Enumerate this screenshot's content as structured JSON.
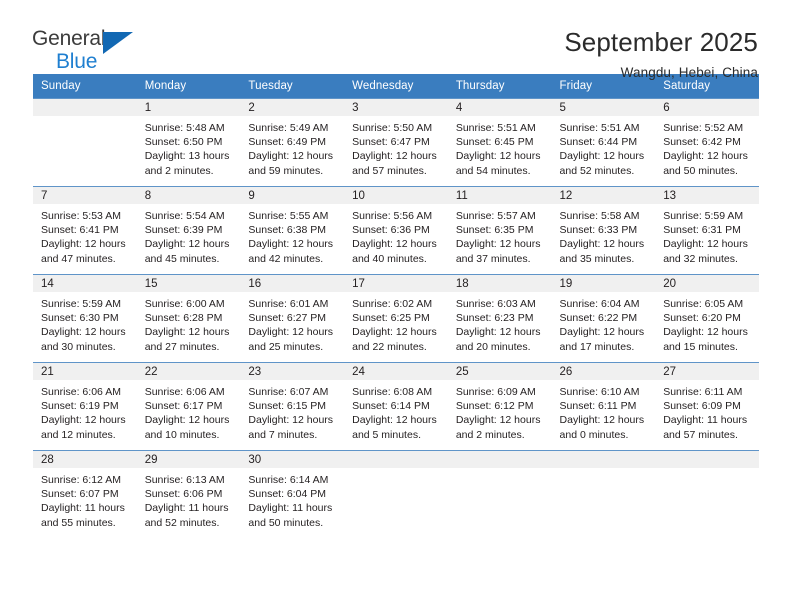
{
  "logo": {
    "word_top": "General",
    "word_bottom": "Blue",
    "triangle_color": "#1268b3",
    "blue_color": "#1f7fd0"
  },
  "header": {
    "title": "September 2025",
    "subtitle": "Wangdu, Hebei, China"
  },
  "theme": {
    "header_blue": "#3a7dbf",
    "daynum_band": "#f0f0f0",
    "text": "#231f20"
  },
  "calendar": {
    "weekday_headers": [
      "Sunday",
      "Monday",
      "Tuesday",
      "Wednesday",
      "Thursday",
      "Friday",
      "Saturday"
    ],
    "weeks": [
      [
        {
          "day": "",
          "sunrise": "",
          "sunset": "",
          "daylight_line1": "",
          "daylight_line2": "",
          "empty": true
        },
        {
          "day": "1",
          "sunrise": "Sunrise: 5:48 AM",
          "sunset": "Sunset: 6:50 PM",
          "daylight_line1": "Daylight: 13 hours",
          "daylight_line2": "and 2 minutes."
        },
        {
          "day": "2",
          "sunrise": "Sunrise: 5:49 AM",
          "sunset": "Sunset: 6:49 PM",
          "daylight_line1": "Daylight: 12 hours",
          "daylight_line2": "and 59 minutes."
        },
        {
          "day": "3",
          "sunrise": "Sunrise: 5:50 AM",
          "sunset": "Sunset: 6:47 PM",
          "daylight_line1": "Daylight: 12 hours",
          "daylight_line2": "and 57 minutes."
        },
        {
          "day": "4",
          "sunrise": "Sunrise: 5:51 AM",
          "sunset": "Sunset: 6:45 PM",
          "daylight_line1": "Daylight: 12 hours",
          "daylight_line2": "and 54 minutes."
        },
        {
          "day": "5",
          "sunrise": "Sunrise: 5:51 AM",
          "sunset": "Sunset: 6:44 PM",
          "daylight_line1": "Daylight: 12 hours",
          "daylight_line2": "and 52 minutes."
        },
        {
          "day": "6",
          "sunrise": "Sunrise: 5:52 AM",
          "sunset": "Sunset: 6:42 PM",
          "daylight_line1": "Daylight: 12 hours",
          "daylight_line2": "and 50 minutes."
        }
      ],
      [
        {
          "day": "7",
          "sunrise": "Sunrise: 5:53 AM",
          "sunset": "Sunset: 6:41 PM",
          "daylight_line1": "Daylight: 12 hours",
          "daylight_line2": "and 47 minutes."
        },
        {
          "day": "8",
          "sunrise": "Sunrise: 5:54 AM",
          "sunset": "Sunset: 6:39 PM",
          "daylight_line1": "Daylight: 12 hours",
          "daylight_line2": "and 45 minutes."
        },
        {
          "day": "9",
          "sunrise": "Sunrise: 5:55 AM",
          "sunset": "Sunset: 6:38 PM",
          "daylight_line1": "Daylight: 12 hours",
          "daylight_line2": "and 42 minutes."
        },
        {
          "day": "10",
          "sunrise": "Sunrise: 5:56 AM",
          "sunset": "Sunset: 6:36 PM",
          "daylight_line1": "Daylight: 12 hours",
          "daylight_line2": "and 40 minutes."
        },
        {
          "day": "11",
          "sunrise": "Sunrise: 5:57 AM",
          "sunset": "Sunset: 6:35 PM",
          "daylight_line1": "Daylight: 12 hours",
          "daylight_line2": "and 37 minutes."
        },
        {
          "day": "12",
          "sunrise": "Sunrise: 5:58 AM",
          "sunset": "Sunset: 6:33 PM",
          "daylight_line1": "Daylight: 12 hours",
          "daylight_line2": "and 35 minutes."
        },
        {
          "day": "13",
          "sunrise": "Sunrise: 5:59 AM",
          "sunset": "Sunset: 6:31 PM",
          "daylight_line1": "Daylight: 12 hours",
          "daylight_line2": "and 32 minutes."
        }
      ],
      [
        {
          "day": "14",
          "sunrise": "Sunrise: 5:59 AM",
          "sunset": "Sunset: 6:30 PM",
          "daylight_line1": "Daylight: 12 hours",
          "daylight_line2": "and 30 minutes."
        },
        {
          "day": "15",
          "sunrise": "Sunrise: 6:00 AM",
          "sunset": "Sunset: 6:28 PM",
          "daylight_line1": "Daylight: 12 hours",
          "daylight_line2": "and 27 minutes."
        },
        {
          "day": "16",
          "sunrise": "Sunrise: 6:01 AM",
          "sunset": "Sunset: 6:27 PM",
          "daylight_line1": "Daylight: 12 hours",
          "daylight_line2": "and 25 minutes."
        },
        {
          "day": "17",
          "sunrise": "Sunrise: 6:02 AM",
          "sunset": "Sunset: 6:25 PM",
          "daylight_line1": "Daylight: 12 hours",
          "daylight_line2": "and 22 minutes."
        },
        {
          "day": "18",
          "sunrise": "Sunrise: 6:03 AM",
          "sunset": "Sunset: 6:23 PM",
          "daylight_line1": "Daylight: 12 hours",
          "daylight_line2": "and 20 minutes."
        },
        {
          "day": "19",
          "sunrise": "Sunrise: 6:04 AM",
          "sunset": "Sunset: 6:22 PM",
          "daylight_line1": "Daylight: 12 hours",
          "daylight_line2": "and 17 minutes."
        },
        {
          "day": "20",
          "sunrise": "Sunrise: 6:05 AM",
          "sunset": "Sunset: 6:20 PM",
          "daylight_line1": "Daylight: 12 hours",
          "daylight_line2": "and 15 minutes."
        }
      ],
      [
        {
          "day": "21",
          "sunrise": "Sunrise: 6:06 AM",
          "sunset": "Sunset: 6:19 PM",
          "daylight_line1": "Daylight: 12 hours",
          "daylight_line2": "and 12 minutes."
        },
        {
          "day": "22",
          "sunrise": "Sunrise: 6:06 AM",
          "sunset": "Sunset: 6:17 PM",
          "daylight_line1": "Daylight: 12 hours",
          "daylight_line2": "and 10 minutes."
        },
        {
          "day": "23",
          "sunrise": "Sunrise: 6:07 AM",
          "sunset": "Sunset: 6:15 PM",
          "daylight_line1": "Daylight: 12 hours",
          "daylight_line2": "and 7 minutes."
        },
        {
          "day": "24",
          "sunrise": "Sunrise: 6:08 AM",
          "sunset": "Sunset: 6:14 PM",
          "daylight_line1": "Daylight: 12 hours",
          "daylight_line2": "and 5 minutes."
        },
        {
          "day": "25",
          "sunrise": "Sunrise: 6:09 AM",
          "sunset": "Sunset: 6:12 PM",
          "daylight_line1": "Daylight: 12 hours",
          "daylight_line2": "and 2 minutes."
        },
        {
          "day": "26",
          "sunrise": "Sunrise: 6:10 AM",
          "sunset": "Sunset: 6:11 PM",
          "daylight_line1": "Daylight: 12 hours",
          "daylight_line2": "and 0 minutes."
        },
        {
          "day": "27",
          "sunrise": "Sunrise: 6:11 AM",
          "sunset": "Sunset: 6:09 PM",
          "daylight_line1": "Daylight: 11 hours",
          "daylight_line2": "and 57 minutes."
        }
      ],
      [
        {
          "day": "28",
          "sunrise": "Sunrise: 6:12 AM",
          "sunset": "Sunset: 6:07 PM",
          "daylight_line1": "Daylight: 11 hours",
          "daylight_line2": "and 55 minutes."
        },
        {
          "day": "29",
          "sunrise": "Sunrise: 6:13 AM",
          "sunset": "Sunset: 6:06 PM",
          "daylight_line1": "Daylight: 11 hours",
          "daylight_line2": "and 52 minutes."
        },
        {
          "day": "30",
          "sunrise": "Sunrise: 6:14 AM",
          "sunset": "Sunset: 6:04 PM",
          "daylight_line1": "Daylight: 11 hours",
          "daylight_line2": "and 50 minutes."
        },
        {
          "day": "",
          "sunrise": "",
          "sunset": "",
          "daylight_line1": "",
          "daylight_line2": "",
          "empty": true
        },
        {
          "day": "",
          "sunrise": "",
          "sunset": "",
          "daylight_line1": "",
          "daylight_line2": "",
          "empty": true
        },
        {
          "day": "",
          "sunrise": "",
          "sunset": "",
          "daylight_line1": "",
          "daylight_line2": "",
          "empty": true
        },
        {
          "day": "",
          "sunrise": "",
          "sunset": "",
          "daylight_line1": "",
          "daylight_line2": "",
          "empty": true
        }
      ]
    ]
  }
}
